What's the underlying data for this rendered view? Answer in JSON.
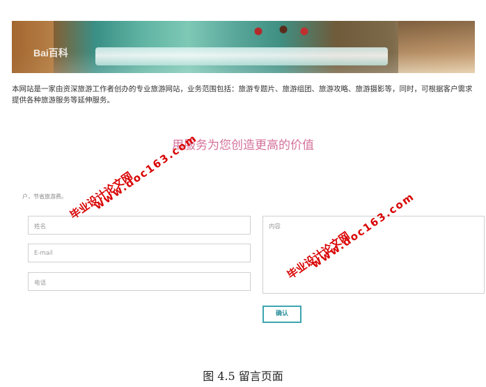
{
  "banner": {
    "logo_text": "Bai百科"
  },
  "intro": {
    "text": "本网站是一家由资深旅游工作者创办的专业旅游网站，业务范围包括：旅游专题片、旅游组团、旅游攻略、旅游摄影等，同时，可根据客户需求提供各种旅游服务等延伸服务。"
  },
  "slogan": "用服务为您创造更高的价值",
  "small_note": "户，节省旅游费。",
  "form": {
    "name_placeholder": "姓名",
    "email_placeholder": "E-mail",
    "phone_placeholder": "电话",
    "content_placeholder": "内容",
    "submit_label": "确认"
  },
  "caption": "图 4.5 留言页面",
  "watermarks": {
    "line1": "毕业设计论文网",
    "line2": "www.doc163.com"
  },
  "colors": {
    "slogan": "#d4709a",
    "button_border": "#3aa5b0",
    "watermark": "#d90000"
  }
}
